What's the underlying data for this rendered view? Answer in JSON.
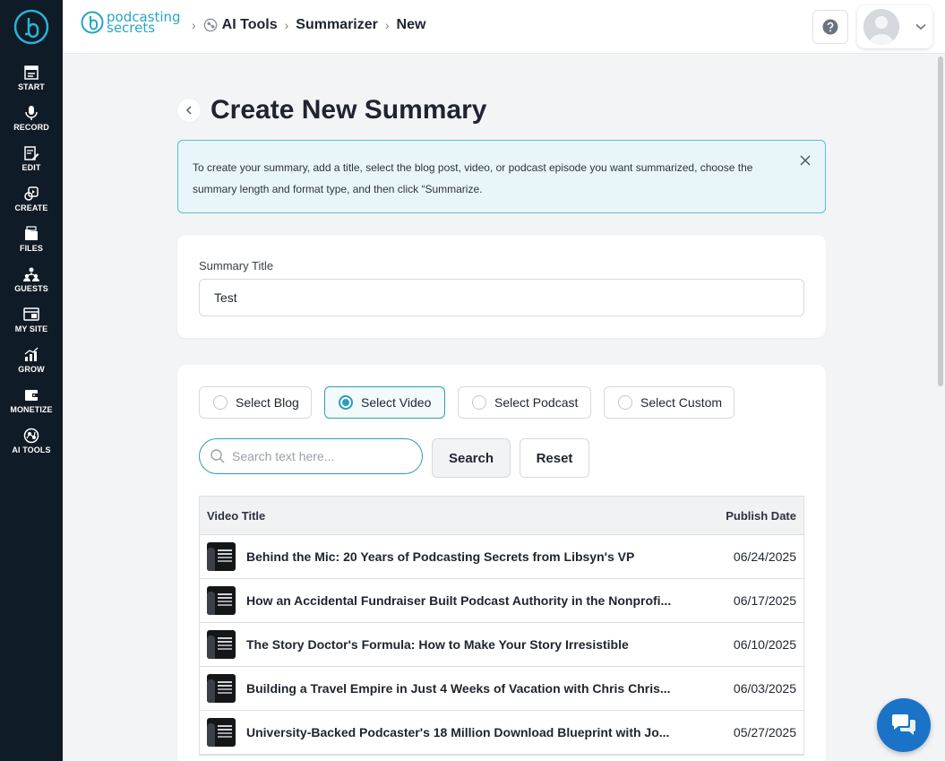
{
  "sidebar": {
    "items": [
      {
        "label": "START",
        "icon": "start-icon"
      },
      {
        "label": "RECORD",
        "icon": "microphone-icon"
      },
      {
        "label": "EDIT",
        "icon": "edit-icon"
      },
      {
        "label": "CREATE",
        "icon": "create-icon"
      },
      {
        "label": "FILES",
        "icon": "files-icon"
      },
      {
        "label": "GUESTS",
        "icon": "guests-icon"
      },
      {
        "label": "MY SITE",
        "icon": "my-site-icon"
      },
      {
        "label": "GROW",
        "icon": "grow-icon"
      },
      {
        "label": "MONETIZE",
        "icon": "monetize-icon"
      },
      {
        "label": "AI TOOLS",
        "icon": "ai-tools-icon"
      }
    ]
  },
  "header": {
    "brand_line1": "podcasting",
    "brand_line2": "secrets",
    "breadcrumbs": [
      "AI Tools",
      "Summarizer",
      "New"
    ]
  },
  "page": {
    "title": "Create New Summary",
    "info_text": "To create your summary, add a title, select the blog post, video, or podcast episode you want summarized, choose the summary length and format type, and then click “Summarize."
  },
  "form": {
    "title_label": "Summary Title",
    "title_value": "Test"
  },
  "source": {
    "options": [
      "Select Blog",
      "Select Video",
      "Select Podcast",
      "Select Custom"
    ],
    "selected": "Select Video",
    "search_placeholder": "Search text here...",
    "search_label": "Search",
    "reset_label": "Reset"
  },
  "table": {
    "columns": [
      "Video Title",
      "Publish Date"
    ],
    "rows": [
      {
        "title": "Behind the Mic: 20 Years of Podcasting Secrets from Libsyn's VP",
        "date": "06/24/2025"
      },
      {
        "title": "How an Accidental Fundraiser Built Podcast Authority in the Nonprofi...",
        "date": "06/17/2025"
      },
      {
        "title": "The Story Doctor's Formula: How to Make Your Story Irresistible",
        "date": "06/10/2025"
      },
      {
        "title": "Building a Travel Empire in Just 4 Weeks of Vacation with Chris Chris...",
        "date": "06/03/2025"
      },
      {
        "title": "University-Backed Podcaster's 18 Million Download Blueprint with Jo...",
        "date": "05/27/2025"
      }
    ]
  },
  "colors": {
    "sidebar_bg": "#0f1b26",
    "accent": "#2a9ebc",
    "info_bg": "#e9f6f9",
    "chat_button": "#1a73c7"
  }
}
